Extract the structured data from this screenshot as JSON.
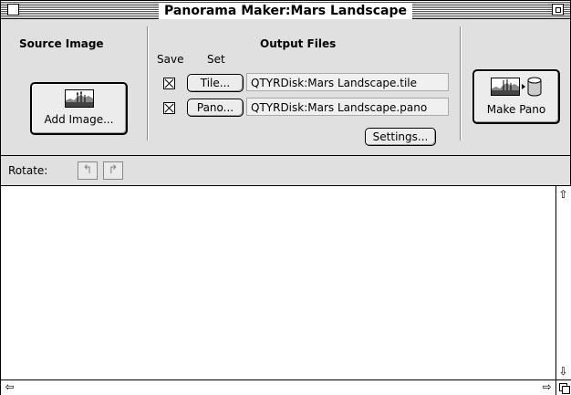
{
  "window": {
    "title": "Panorama Maker:Mars Landscape"
  },
  "source": {
    "heading": "Source Image",
    "add_label": "Add Image...",
    "add_icon": "panorama-image-icon"
  },
  "output": {
    "heading": "Output Files",
    "save_col": "Save",
    "set_col": "Set",
    "rows": [
      {
        "button": "Tile...",
        "path": "QTYRDisk:Mars Landscape.tile",
        "saved": true
      },
      {
        "button": "Pano...",
        "path": "QTYRDisk:Mars Landscape.pano",
        "saved": true
      }
    ],
    "settings_label": "Settings..."
  },
  "make": {
    "label": "Make Pano",
    "icon": "panorama-to-disk-icon"
  },
  "rotate": {
    "label": "Rotate:",
    "left_icon": "rotate-left-icon",
    "right_icon": "rotate-right-icon"
  },
  "scroll": {
    "up": "⇧",
    "down": "⇩",
    "left": "⇦",
    "right": "⇨"
  }
}
